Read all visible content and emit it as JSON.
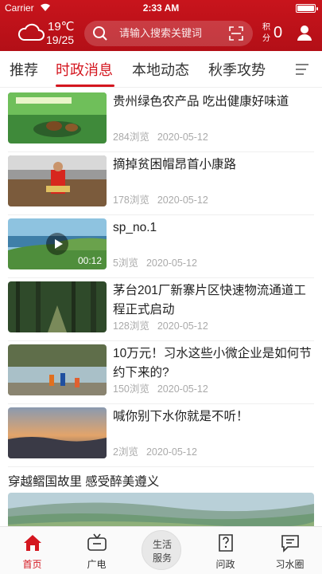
{
  "status": {
    "carrier": "Carrier",
    "time": "2:33 AM",
    "battery_level": 1.0
  },
  "weather": {
    "temp": "19℃",
    "range": "19/25",
    "icon": "cloud-icon"
  },
  "search": {
    "placeholder": "请输入搜索关键词"
  },
  "points": {
    "label": "积分",
    "value": "0"
  },
  "tabs": [
    {
      "label": "推荐"
    },
    {
      "label": "时政消息",
      "active": true
    },
    {
      "label": "本地动态"
    },
    {
      "label": "秋季攻势"
    }
  ],
  "news": [
    {
      "title": "贵州绿色农产品 吃出健康好味道",
      "views": "284浏览",
      "date": "2020-05-12"
    },
    {
      "title": "摘掉贫困帽昂首小康路",
      "views": "178浏览",
      "date": "2020-05-12"
    },
    {
      "title": "sp_no.1",
      "views": "5浏览",
      "date": "2020-05-12",
      "duration": "00:12"
    },
    {
      "title": "茅台201厂新寨片区快速物流通道工程正式启动",
      "views": "128浏览",
      "date": "2020-05-12"
    },
    {
      "title": "10万元！习水这些小微企业是如何节约下来的?",
      "views": "150浏览",
      "date": "2020-05-12"
    },
    {
      "title": "喊你别下水你就是不听！",
      "views": "2浏览",
      "date": "2020-05-12"
    }
  ],
  "feature": {
    "title": "穿越鳛国故里 感受醉美遵义"
  },
  "bottom_nav": [
    {
      "label": "首页",
      "icon": "home-icon",
      "active": true
    },
    {
      "label": "广电",
      "icon": "tv-icon"
    },
    {
      "label": "生活服务",
      "line1": "生活",
      "line2": "服务"
    },
    {
      "label": "问政",
      "icon": "question-icon"
    },
    {
      "label": "习水圈",
      "icon": "chat-icon"
    }
  ],
  "colors": {
    "brand_red": "#c8141c",
    "accent": "#d4161f"
  }
}
